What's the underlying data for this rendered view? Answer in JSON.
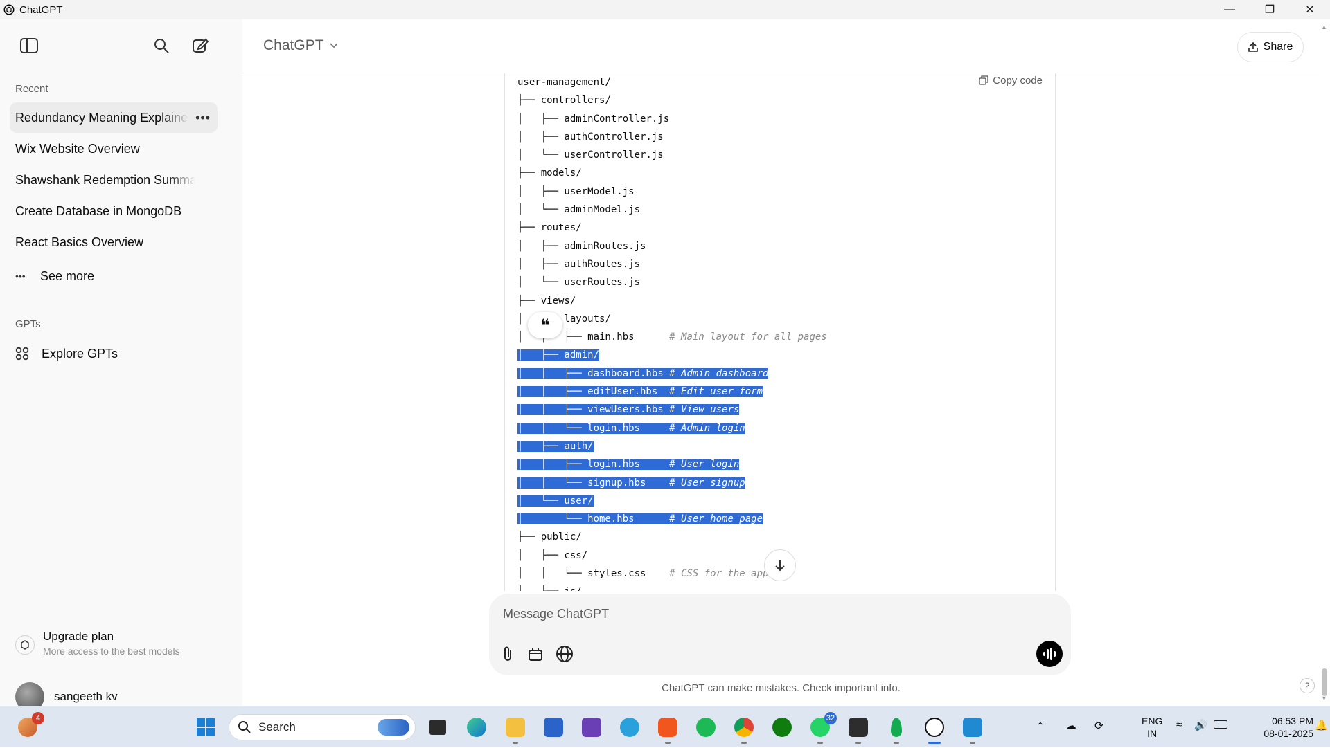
{
  "window": {
    "title": "ChatGPT"
  },
  "sidebar": {
    "recent_label": "Recent",
    "recent": [
      {
        "label": "Redundancy Meaning Explained",
        "active": true
      },
      {
        "label": "Wix Website Overview"
      },
      {
        "label": "Shawshank Redemption Summary"
      },
      {
        "label": "Create Database in MongoDB"
      },
      {
        "label": "React Basics Overview"
      }
    ],
    "see_more": "See more",
    "gpts_label": "GPTs",
    "explore_gpts": "Explore GPTs",
    "upgrade": {
      "title": "Upgrade plan",
      "subtitle": "More access to the best models"
    },
    "user": {
      "name": "sangeeth kv"
    }
  },
  "header": {
    "model": "ChatGPT",
    "share": "Share"
  },
  "code": {
    "copy_label": "Copy code",
    "lines": [
      {
        "text": "user-management/"
      },
      {
        "text": "├── controllers/"
      },
      {
        "text": "│   ├── adminController.js"
      },
      {
        "text": "│   ├── authController.js"
      },
      {
        "text": "│   └── userController.js"
      },
      {
        "text": "├── models/"
      },
      {
        "text": "│   ├── userModel.js"
      },
      {
        "text": "│   └── adminModel.js"
      },
      {
        "text": "├── routes/"
      },
      {
        "text": "│   ├── adminRoutes.js"
      },
      {
        "text": "│   ├── authRoutes.js"
      },
      {
        "text": "│   └── userRoutes.js"
      },
      {
        "text": "├── views/"
      },
      {
        "text": "│   ├── layouts/"
      },
      {
        "text": "│   │   ├── main.hbs      ",
        "comment": "# Main layout for all pages"
      },
      {
        "text": "│   ├── admin/",
        "hl": true
      },
      {
        "text": "│   │   ├── dashboard.hbs ",
        "comment": "# Admin dashboard",
        "hl": true
      },
      {
        "text": "│   │   ├── editUser.hbs  ",
        "comment": "# Edit user form",
        "hl": true
      },
      {
        "text": "│   │   ├── viewUsers.hbs ",
        "comment": "# View users",
        "hl": true
      },
      {
        "text": "│   │   └── login.hbs     ",
        "comment": "# Admin login",
        "hl": true
      },
      {
        "text": "│   ├── auth/",
        "hl": true
      },
      {
        "text": "│   │   ├── login.hbs     ",
        "comment": "# User login",
        "hl": true
      },
      {
        "text": "│   │   └── signup.hbs    ",
        "comment": "# User signup",
        "hl": true
      },
      {
        "text": "│   └── user/",
        "hl": true
      },
      {
        "text": "│       └── home.hbs      ",
        "comment": "# User home page",
        "hl": true
      },
      {
        "text": "├── public/"
      },
      {
        "text": "│   ├── css/"
      },
      {
        "text": "│   │   └── styles.css    ",
        "comment": "# CSS for the app"
      },
      {
        "text": "│   ├── js/"
      }
    ]
  },
  "composer": {
    "placeholder": "Message ChatGPT"
  },
  "disclaimer": "ChatGPT can make mistakes. Check important info.",
  "help": "?",
  "taskbar": {
    "search": "Search",
    "widgets_badge": "4",
    "whatsapp_badge": "32",
    "lang_1": "ENG",
    "lang_2": "IN",
    "time": "06:53 PM",
    "date": "08-01-2025"
  },
  "colors": {
    "selection": "#2f6bd7",
    "sidebar_bg": "#f9f9f9",
    "taskbar_bg": "#dde6f1"
  }
}
